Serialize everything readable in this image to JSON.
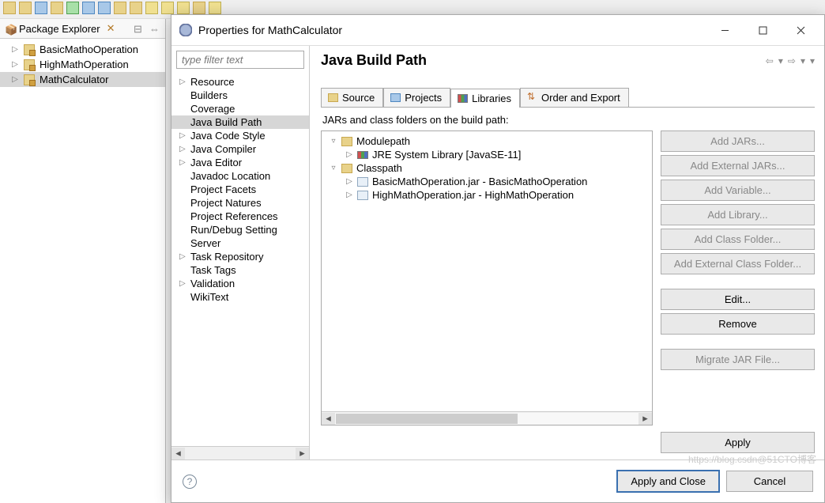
{
  "packageExplorer": {
    "title": "Package Explorer",
    "items": [
      {
        "label": "BasicMathoOperation",
        "selected": false
      },
      {
        "label": "HighMathOperation",
        "selected": false
      },
      {
        "label": "MathCalculator",
        "selected": true
      }
    ]
  },
  "dialog": {
    "title": "Properties for MathCalculator",
    "filterPlaceholder": "type filter text",
    "nav": [
      {
        "label": "Resource",
        "expandable": true
      },
      {
        "label": "Builders",
        "expandable": false
      },
      {
        "label": "Coverage",
        "expandable": false
      },
      {
        "label": "Java Build Path",
        "expandable": false,
        "selected": true
      },
      {
        "label": "Java Code Style",
        "expandable": true
      },
      {
        "label": "Java Compiler",
        "expandable": true
      },
      {
        "label": "Java Editor",
        "expandable": true
      },
      {
        "label": "Javadoc Location",
        "expandable": false
      },
      {
        "label": "Project Facets",
        "expandable": false
      },
      {
        "label": "Project Natures",
        "expandable": false
      },
      {
        "label": "Project References",
        "expandable": false
      },
      {
        "label": "Run/Debug Settings",
        "expandable": false,
        "displayLabel": "Run/Debug Setting"
      },
      {
        "label": "Server",
        "expandable": false
      },
      {
        "label": "Task Repository",
        "expandable": true
      },
      {
        "label": "Task Tags",
        "expandable": false
      },
      {
        "label": "Validation",
        "expandable": true
      },
      {
        "label": "WikiText",
        "expandable": false
      }
    ],
    "sectionTitle": "Java Build Path",
    "tabs": [
      {
        "label": "Source",
        "icon": "folder"
      },
      {
        "label": "Projects",
        "icon": "folder-blue"
      },
      {
        "label": "Libraries",
        "icon": "books",
        "active": true
      },
      {
        "label": "Order and Export",
        "icon": "arrows"
      }
    ],
    "description": "JARs and class folders on the build path:",
    "tree": {
      "modulepath": {
        "label": "Modulepath",
        "children": [
          {
            "label": "JRE System Library [JavaSE-11]",
            "icon": "lib"
          }
        ]
      },
      "classpath": {
        "label": "Classpath",
        "children": [
          {
            "label": "BasicMathOperation.jar - BasicMathoOperation",
            "icon": "jar"
          },
          {
            "label": "HighMathOperation.jar - HighMathOperation",
            "icon": "jar"
          }
        ]
      }
    },
    "buttons": {
      "addJars": "Add JARs...",
      "addExtJars": "Add External JARs...",
      "addVar": "Add Variable...",
      "addLib": "Add Library...",
      "addClassFolder": "Add Class Folder...",
      "addExtClassFolder": "Add External Class Folder...",
      "edit": "Edit...",
      "remove": "Remove",
      "migrate": "Migrate JAR File...",
      "apply": "Apply",
      "applyClose": "Apply and Close",
      "cancel": "Cancel"
    },
    "watermark": "https://blog.csdn@51CTO博客"
  }
}
